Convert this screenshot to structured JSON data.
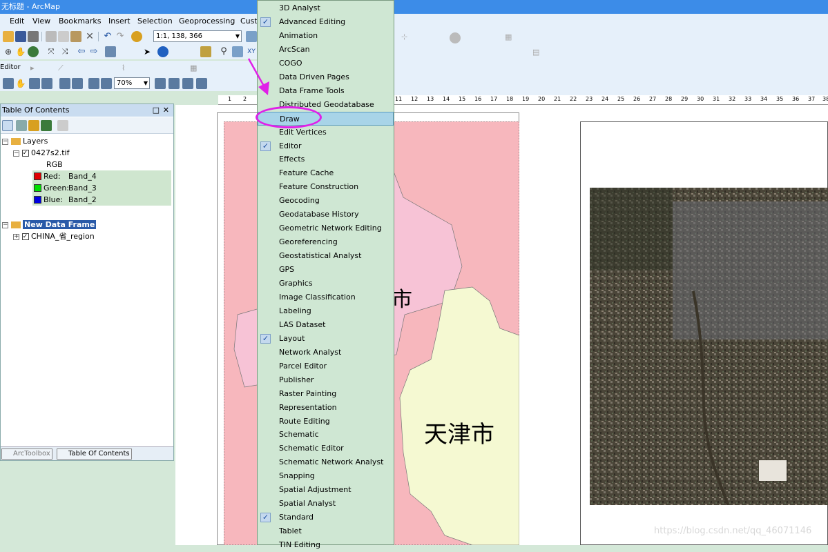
{
  "window": {
    "title": "无标题 - ArcMap"
  },
  "menubar": [
    "Edit",
    "View",
    "Bookmarks",
    "Insert",
    "Selection",
    "Geoprocessing",
    "Cust"
  ],
  "toolbar": {
    "scale_value": "1:1, 138, 366",
    "zoom_value": "70%",
    "editor_label": "Editor"
  },
  "toc": {
    "title": "Table Of Contents",
    "layers_label": "Layers",
    "raster_layer": "0427s2.tif",
    "rgb_label": "RGB",
    "bands": [
      {
        "label": "Red:",
        "value": "Band_4",
        "color": "#e00000"
      },
      {
        "label": "Green:",
        "value": "Band_3",
        "color": "#00e000"
      },
      {
        "label": "Blue:",
        "value": "Band_2",
        "color": "#0000e0"
      }
    ],
    "data_frame": "New Data Frame",
    "vector_layer": "CHINA_省_region",
    "tabs": [
      "ArcToolbox",
      "Table Of Contents"
    ]
  },
  "ruler_ticks": [
    "1",
    "2",
    "11",
    "12",
    "13",
    "14",
    "15",
    "16",
    "17",
    "18",
    "19",
    "20",
    "21",
    "22",
    "23",
    "24",
    "25",
    "26",
    "27",
    "28",
    "29",
    "30",
    "31",
    "32",
    "33",
    "34",
    "35",
    "36",
    "37",
    "38"
  ],
  "map": {
    "label_tianjin": "天津市",
    "label_partial": "市"
  },
  "dropdown": {
    "items": [
      {
        "label": "3D Analyst",
        "checked": false
      },
      {
        "label": "Advanced Editing",
        "checked": true
      },
      {
        "label": "Animation",
        "checked": false
      },
      {
        "label": "ArcScan",
        "checked": false
      },
      {
        "label": "COGO",
        "checked": false
      },
      {
        "label": "Data Driven Pages",
        "checked": false
      },
      {
        "label": "Data Frame Tools",
        "checked": false
      },
      {
        "label": "Distributed Geodatabase",
        "checked": false
      },
      {
        "label": "Draw",
        "checked": false,
        "highlighted": true
      },
      {
        "label": "Edit Vertices",
        "checked": false
      },
      {
        "label": "Editor",
        "checked": true
      },
      {
        "label": "Effects",
        "checked": false
      },
      {
        "label": "Feature Cache",
        "checked": false
      },
      {
        "label": "Feature Construction",
        "checked": false
      },
      {
        "label": "Geocoding",
        "checked": false
      },
      {
        "label": "Geodatabase History",
        "checked": false
      },
      {
        "label": "Geometric Network Editing",
        "checked": false
      },
      {
        "label": "Georeferencing",
        "checked": false
      },
      {
        "label": "Geostatistical Analyst",
        "checked": false
      },
      {
        "label": "GPS",
        "checked": false
      },
      {
        "label": "Graphics",
        "checked": false
      },
      {
        "label": "Image Classification",
        "checked": false
      },
      {
        "label": "Labeling",
        "checked": false
      },
      {
        "label": "LAS Dataset",
        "checked": false
      },
      {
        "label": "Layout",
        "checked": true
      },
      {
        "label": "Network Analyst",
        "checked": false
      },
      {
        "label": "Parcel Editor",
        "checked": false
      },
      {
        "label": "Publisher",
        "checked": false
      },
      {
        "label": "Raster Painting",
        "checked": false
      },
      {
        "label": "Representation",
        "checked": false
      },
      {
        "label": "Route Editing",
        "checked": false
      },
      {
        "label": "Schematic",
        "checked": false
      },
      {
        "label": "Schematic Editor",
        "checked": false
      },
      {
        "label": "Schematic Network Analyst",
        "checked": false
      },
      {
        "label": "Snapping",
        "checked": false
      },
      {
        "label": "Spatial Adjustment",
        "checked": false
      },
      {
        "label": "Spatial Analyst",
        "checked": false
      },
      {
        "label": "Standard",
        "checked": true
      },
      {
        "label": "Tablet",
        "checked": false
      },
      {
        "label": "TIN Editing",
        "checked": false
      }
    ]
  },
  "watermark": "https://blog.csdn.net/qq_46071146",
  "colors": {
    "accent": "#3c8ce8",
    "annotation": "#e020e8",
    "menu_bg": "#cfe7d3",
    "map_pink": "#f7b7bd",
    "map_lightpink": "#f7c3d6",
    "map_yellow": "#f5f9d2"
  }
}
